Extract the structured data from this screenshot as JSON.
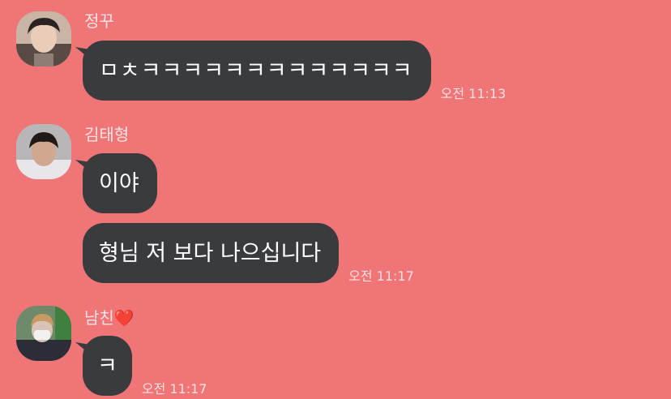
{
  "messages": [
    {
      "sender": "정꾸",
      "bubbles": [
        {
          "text": "ㅁㅊㅋㅋㅋㅋㅋㅋㅋㅋㅋㅋㅋㅋㅋ",
          "time": "오전 11:13"
        }
      ]
    },
    {
      "sender": "김태형",
      "bubbles": [
        {
          "text": "이야",
          "time": ""
        },
        {
          "text": "형님 저 보다 나으십니다",
          "time": "오전 11:17"
        }
      ]
    },
    {
      "sender": "남친❤️",
      "bubbles": [
        {
          "text": "ㅋ",
          "time": "오전 11:17"
        }
      ]
    }
  ],
  "colors": {
    "background": "#f07577",
    "bubble": "#3a3b3f",
    "sender_text": "#fbe3e3",
    "timestamp": "#fbe0e0"
  }
}
